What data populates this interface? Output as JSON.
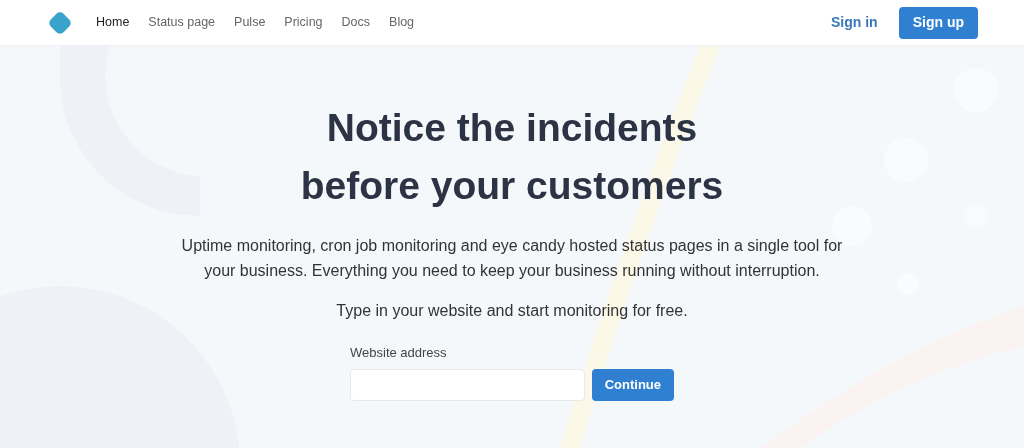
{
  "nav": {
    "items": [
      {
        "label": "Home",
        "selected": true
      },
      {
        "label": "Status page",
        "selected": false
      },
      {
        "label": "Pulse",
        "selected": false
      },
      {
        "label": "Pricing",
        "selected": false
      },
      {
        "label": "Docs",
        "selected": false
      },
      {
        "label": "Blog",
        "selected": false
      }
    ],
    "sign_in": "Sign in",
    "sign_up": "Sign up"
  },
  "hero": {
    "title_lines": [
      "Notice the incidents",
      "before your customers"
    ],
    "description": "Uptime monitoring, cron job monitoring and eye candy hosted status pages in a single tool for your business. Everything you need to keep your business running without interruption.",
    "prompt": "Type in your website and start monitoring for free.",
    "field_label": "Website address",
    "button": "Continue"
  }
}
